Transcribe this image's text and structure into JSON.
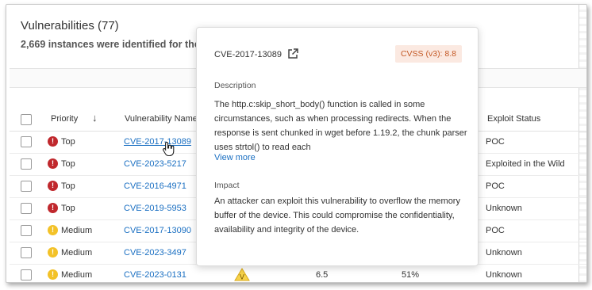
{
  "header": {
    "title": "Vulnerabilities (77)",
    "subtitle": "2,669 instances were identified for the"
  },
  "table": {
    "columns": {
      "priority": "Priority",
      "name": "Vulnerability Name",
      "exploit": "Exploit Status"
    },
    "rows": [
      {
        "priority": "Top",
        "level": "top",
        "name": "CVE-2017-13089",
        "exploit": "POC"
      },
      {
        "priority": "Top",
        "level": "top",
        "name": "CVE-2023-5217",
        "exploit": "Exploited in the Wild"
      },
      {
        "priority": "Top",
        "level": "top",
        "name": "CVE-2016-4971",
        "exploit": "POC"
      },
      {
        "priority": "Top",
        "level": "top",
        "name": "CVE-2019-5953",
        "exploit": "Unknown"
      },
      {
        "priority": "Medium",
        "level": "medium",
        "name": "CVE-2017-13090",
        "exploit": "POC"
      },
      {
        "priority": "Medium",
        "level": "medium",
        "name": "CVE-2023-3497",
        "exploit": "Unknown"
      },
      {
        "priority": "Medium",
        "level": "medium",
        "name": "CVE-2023-0131",
        "exploit": "Unknown",
        "cvss": "6.5",
        "percent": "51%"
      }
    ]
  },
  "popover": {
    "cve": "CVE-2017-13089",
    "cvss_badge": "CVSS (v3): 8.8",
    "description_heading": "Description",
    "description": "The http.c:skip_short_body() function is called in some circumstances, such as when processing redirects. When the response is sent chunked in wget before 1.19.2, the chunk parser uses strtol() to read each",
    "view_more": "View more",
    "impact_heading": "Impact",
    "impact": "An attacker can exploit this vulnerability to overflow the memory buffer of the device. This could compromise the confidentiality, availability and integrity of the device."
  },
  "icons": {
    "sort": "arrow-down-icon",
    "external": "external-link-icon",
    "priority_top": "error-circle-icon",
    "priority_medium": "warning-circle-icon",
    "cursor": "hand-pointer-icon",
    "warning_triangle": "warning-triangle-icon"
  },
  "colors": {
    "link": "#1a6fc2",
    "top": "#c0282d",
    "medium": "#f3c228",
    "cvss_badge_bg": "#fbe9e1",
    "cvss_badge_text": "#c45a27"
  }
}
